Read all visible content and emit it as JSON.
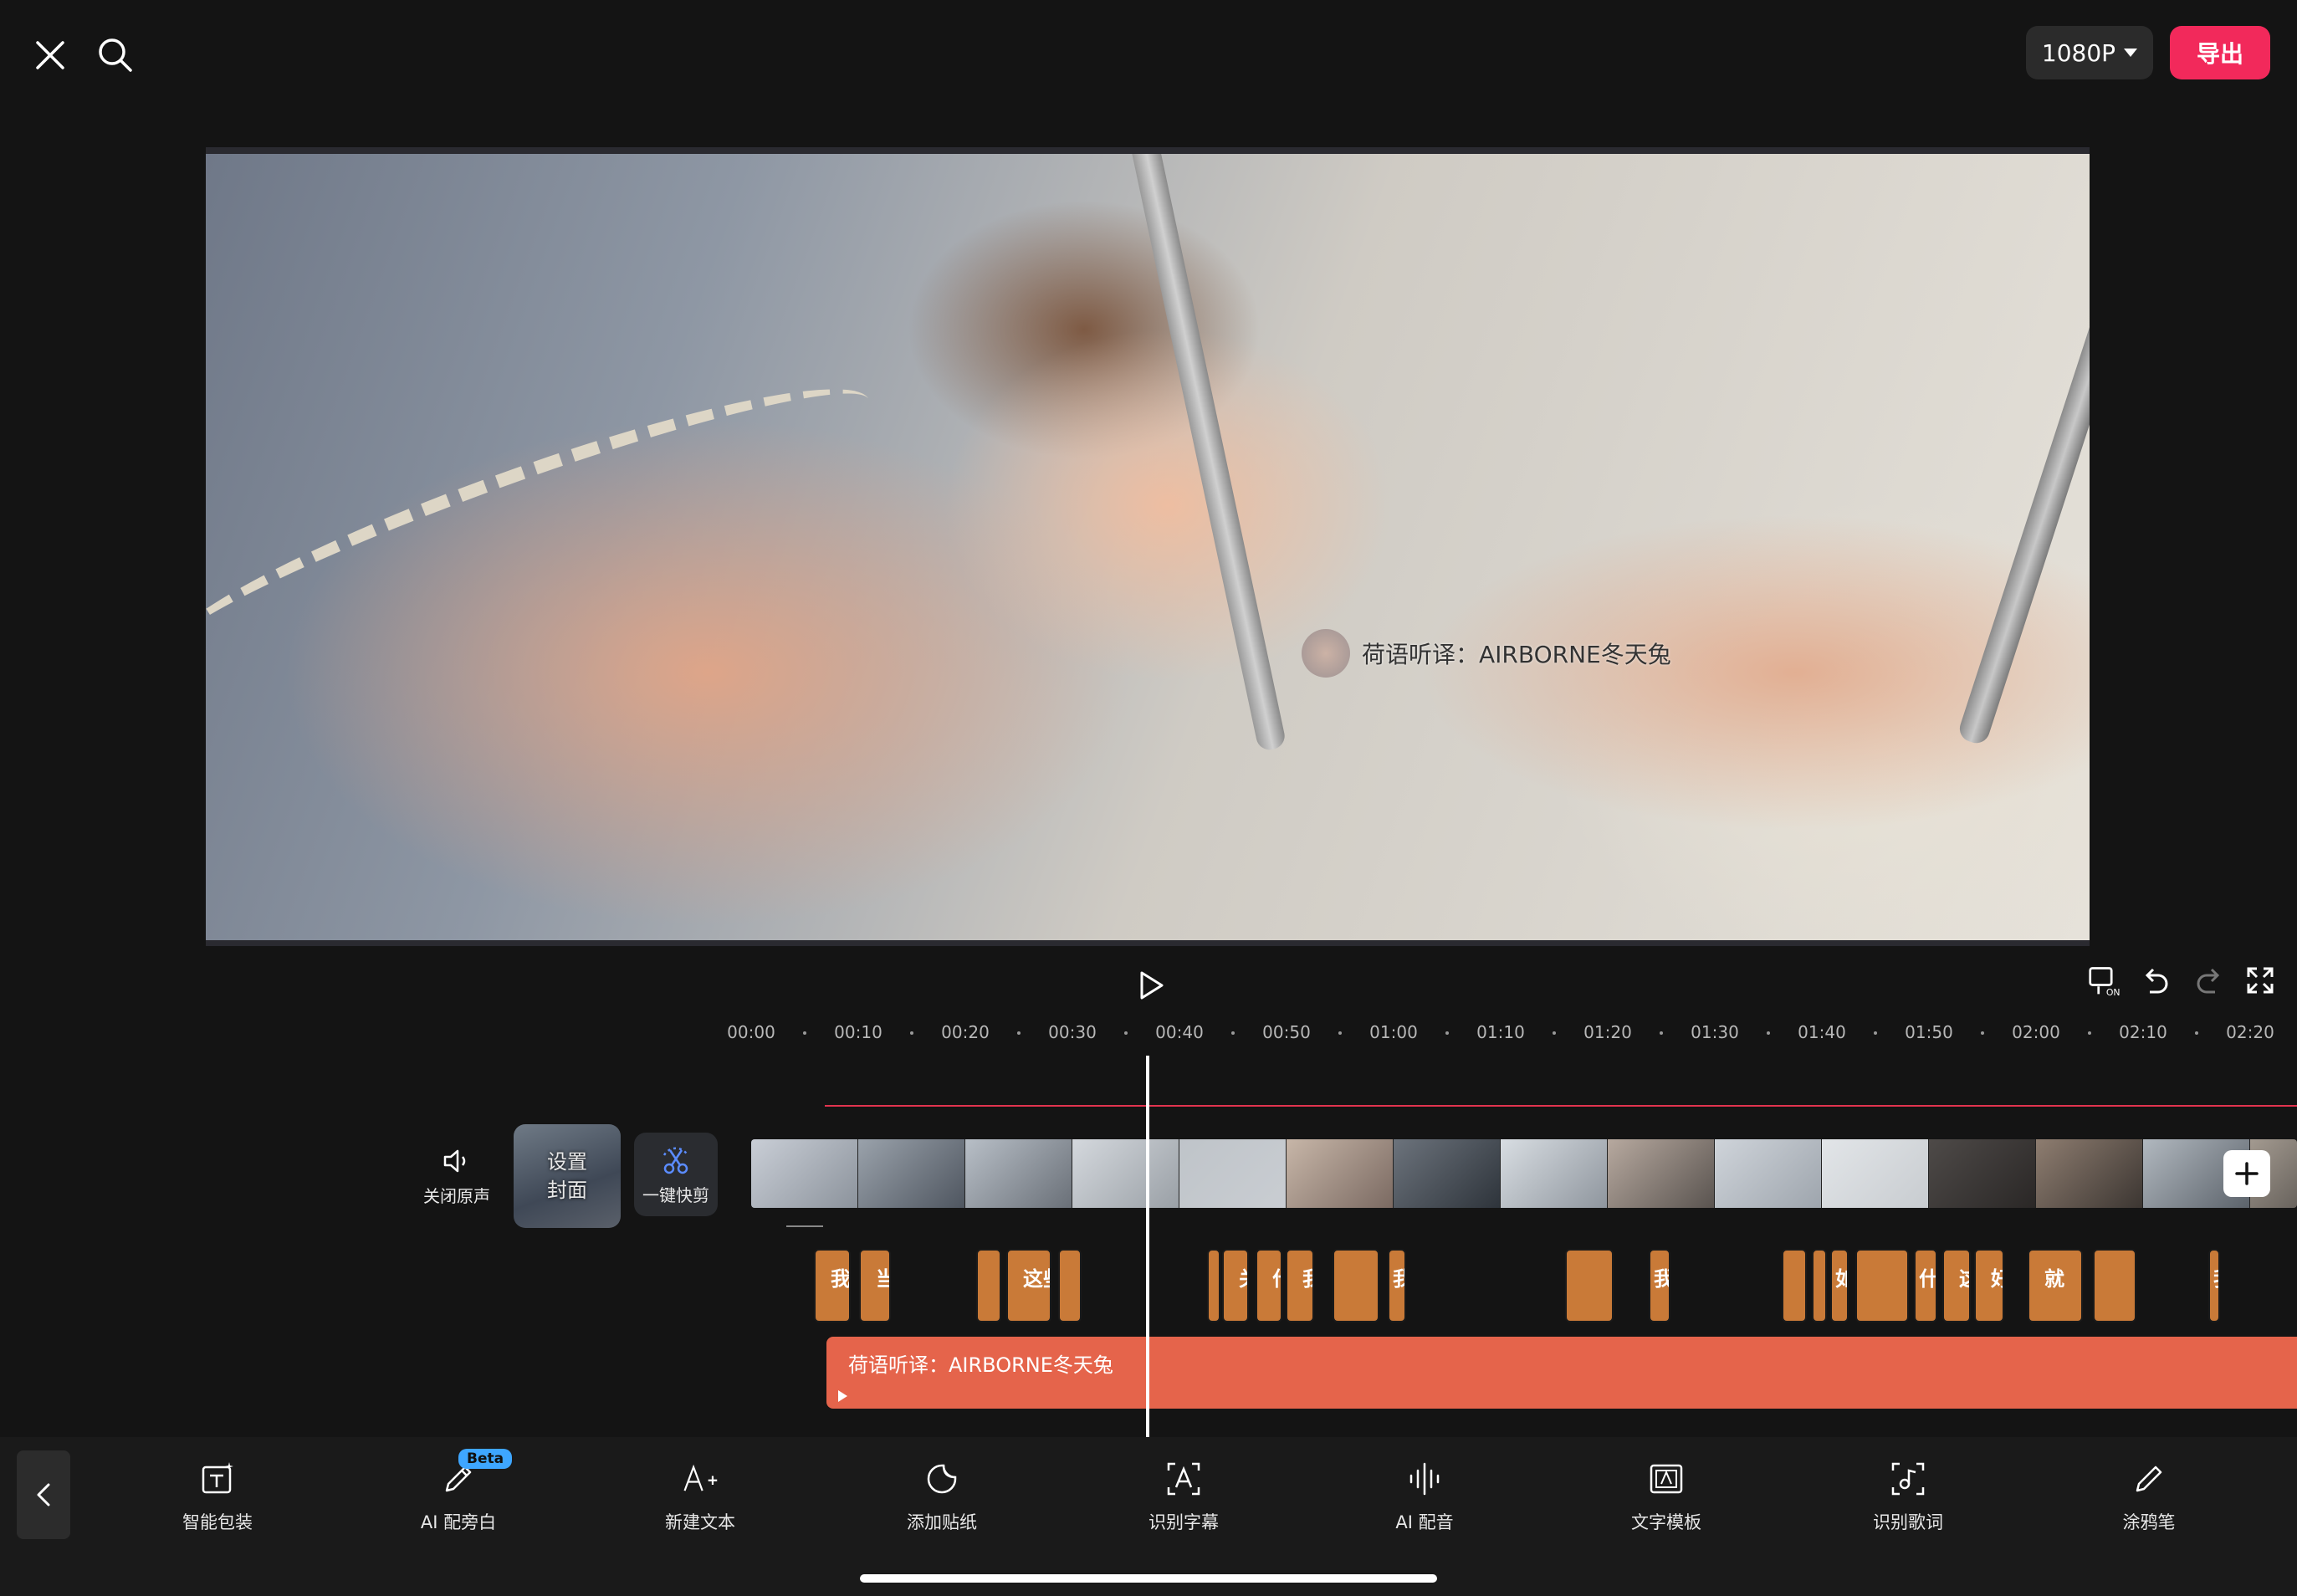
{
  "topbar": {
    "close_icon": "close-icon",
    "search_icon": "search-icon",
    "resolution": "1080P",
    "export_label": "导出"
  },
  "preview": {
    "watermark_text": "荷语听译：AIRBORNE冬天兔"
  },
  "transport": {
    "play_icon": "play-icon",
    "tools": [
      "keyframe-on-icon",
      "undo-icon",
      "redo-icon",
      "fullscreen-icon"
    ],
    "keyframe_badge": "ON"
  },
  "ruler": {
    "ticks": [
      "00:00",
      "00:10",
      "00:20",
      "00:30",
      "00:40",
      "00:50",
      "01:00",
      "01:10",
      "01:20",
      "01:30",
      "01:40",
      "01:50",
      "02:00",
      "02:10",
      "02:20"
    ]
  },
  "timeline": {
    "mute_label": "关闭原声",
    "cover_label": "设置封面",
    "quickcut_label": "一键快剪",
    "subtitle_clips": [
      "我",
      "当",
      "",
      "这些",
      "",
      "",
      "关",
      "什",
      "我",
      "",
      "我的",
      "",
      "我觉",
      "",
      "",
      "如果",
      "",
      "什么",
      "这",
      "好的",
      "就",
      "",
      "我"
    ],
    "text_clip_label": "荷语听译：AIRBORNE冬天兔"
  },
  "toolbar": {
    "items": [
      {
        "label": "智能包装",
        "icon": "smart-pack-icon"
      },
      {
        "label": "AI 配旁白",
        "icon": "ai-narration-icon"
      },
      {
        "label": "新建文本",
        "icon": "new-text-icon"
      },
      {
        "label": "添加贴纸",
        "icon": "sticker-icon"
      },
      {
        "label": "识别字幕",
        "icon": "recognize-subtitle-icon"
      },
      {
        "label": "AI 配音",
        "icon": "ai-voice-icon"
      },
      {
        "label": "文字模板",
        "icon": "text-template-icon"
      },
      {
        "label": "识别歌词",
        "icon": "recognize-lyrics-icon"
      },
      {
        "label": "涂鸦笔",
        "icon": "doodle-pen-icon"
      }
    ],
    "beta_badge": "Beta"
  },
  "colors": {
    "accent_red": "#f2295b",
    "subtitle_clip": "#c97a38",
    "text_clip": "#e5644b"
  }
}
